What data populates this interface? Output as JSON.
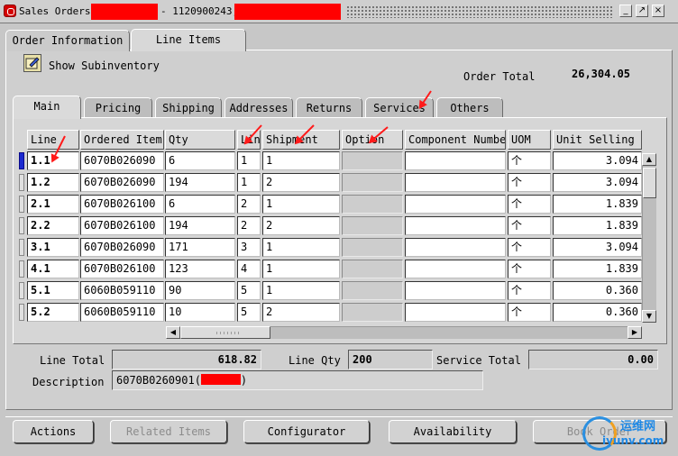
{
  "title": {
    "app_name": "Sales Orders",
    "order_text": " - 1120900243,",
    "buttons": {
      "minimize": "_",
      "restore": "↗",
      "close": "×"
    }
  },
  "top_tabs": [
    "Order Information",
    "Line Items"
  ],
  "toolbar": {
    "show_subinventory": "Show Subinventory",
    "icon": "edit-box-icon"
  },
  "order_total": {
    "label": "Order Total",
    "value": "26,304.05"
  },
  "sub_tabs": [
    "Main",
    "Pricing",
    "Shipping",
    "Addresses",
    "Returns",
    "Services",
    "Others"
  ],
  "grid": {
    "columns": [
      "Line",
      "Ordered Item",
      "Qty",
      "Lin",
      "Shipment",
      "Option",
      "Component Number",
      "UOM",
      "Unit Selling Price"
    ],
    "rows": [
      {
        "line": "1.1",
        "item": "6070B026090",
        "qty": "6",
        "lin": "1",
        "shipment": "1",
        "option": "",
        "component": "",
        "uom": "个",
        "price": "3.094"
      },
      {
        "line": "1.2",
        "item": "6070B026090",
        "qty": "194",
        "lin": "1",
        "shipment": "2",
        "option": "",
        "component": "",
        "uom": "个",
        "price": "3.094"
      },
      {
        "line": "2.1",
        "item": "6070B026100",
        "qty": "6",
        "lin": "2",
        "shipment": "1",
        "option": "",
        "component": "",
        "uom": "个",
        "price": "1.839"
      },
      {
        "line": "2.2",
        "item": "6070B026100",
        "qty": "194",
        "lin": "2",
        "shipment": "2",
        "option": "",
        "component": "",
        "uom": "个",
        "price": "1.839"
      },
      {
        "line": "3.1",
        "item": "6070B026090",
        "qty": "171",
        "lin": "3",
        "shipment": "1",
        "option": "",
        "component": "",
        "uom": "个",
        "price": "3.094"
      },
      {
        "line": "4.1",
        "item": "6070B026100",
        "qty": "123",
        "lin": "4",
        "shipment": "1",
        "option": "",
        "component": "",
        "uom": "个",
        "price": "1.839"
      },
      {
        "line": "5.1",
        "item": "6060B059110",
        "qty": "90",
        "lin": "5",
        "shipment": "1",
        "option": "",
        "component": "",
        "uom": "个",
        "price": "0.360"
      },
      {
        "line": "5.2",
        "item": "6060B059110",
        "qty": "10",
        "lin": "5",
        "shipment": "2",
        "option": "",
        "component": "",
        "uom": "个",
        "price": "0.360"
      }
    ]
  },
  "summary": {
    "line_total_label": "Line Total",
    "line_total_value": "618.82",
    "line_qty_label": "Line Qty",
    "line_qty_value": "200",
    "service_total_label": "Service Total",
    "service_total_value": "0.00",
    "description_label": "Description",
    "description_value": "6070B0260901(",
    "description_suffix": ")"
  },
  "buttons": [
    {
      "label": "Actions",
      "enabled": true
    },
    {
      "label": "Related Items",
      "enabled": false
    },
    {
      "label": "Configurator",
      "enabled": true
    },
    {
      "label": "Availability",
      "enabled": true
    },
    {
      "label": "Book Order",
      "enabled": false
    }
  ],
  "watermark": {
    "brand": "运维网",
    "url": "iyunv.com"
  },
  "colors": {
    "redaction": "#ff0000",
    "annotation_arrow": "#ff1a1a",
    "current_row": "#1b2ad0"
  }
}
